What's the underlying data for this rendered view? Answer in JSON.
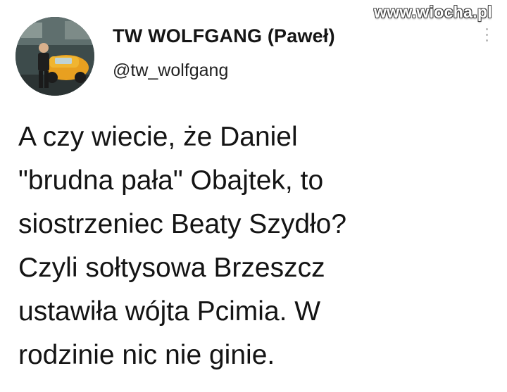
{
  "author": {
    "display_name": "TW WOLFGANG (Paweł)",
    "handle": "@tw_wolfgang"
  },
  "tweet": {
    "text": "A czy wiecie, że Daniel\n\"brudna pała\" Obajtek, to\nsiostrzeniec Beaty Szydło?\nCzyli sołtysowa Brzeszcz\nustawiła wójta Pcimia. W\nrodzinie nic nie ginie."
  },
  "watermark": {
    "text": "www.wiocha.pl"
  },
  "icons": {
    "more": "more-vertical-icon",
    "avatar": "profile-photo"
  },
  "colors": {
    "background": "#ffffff",
    "text": "#141414",
    "car": "#e8a020"
  }
}
